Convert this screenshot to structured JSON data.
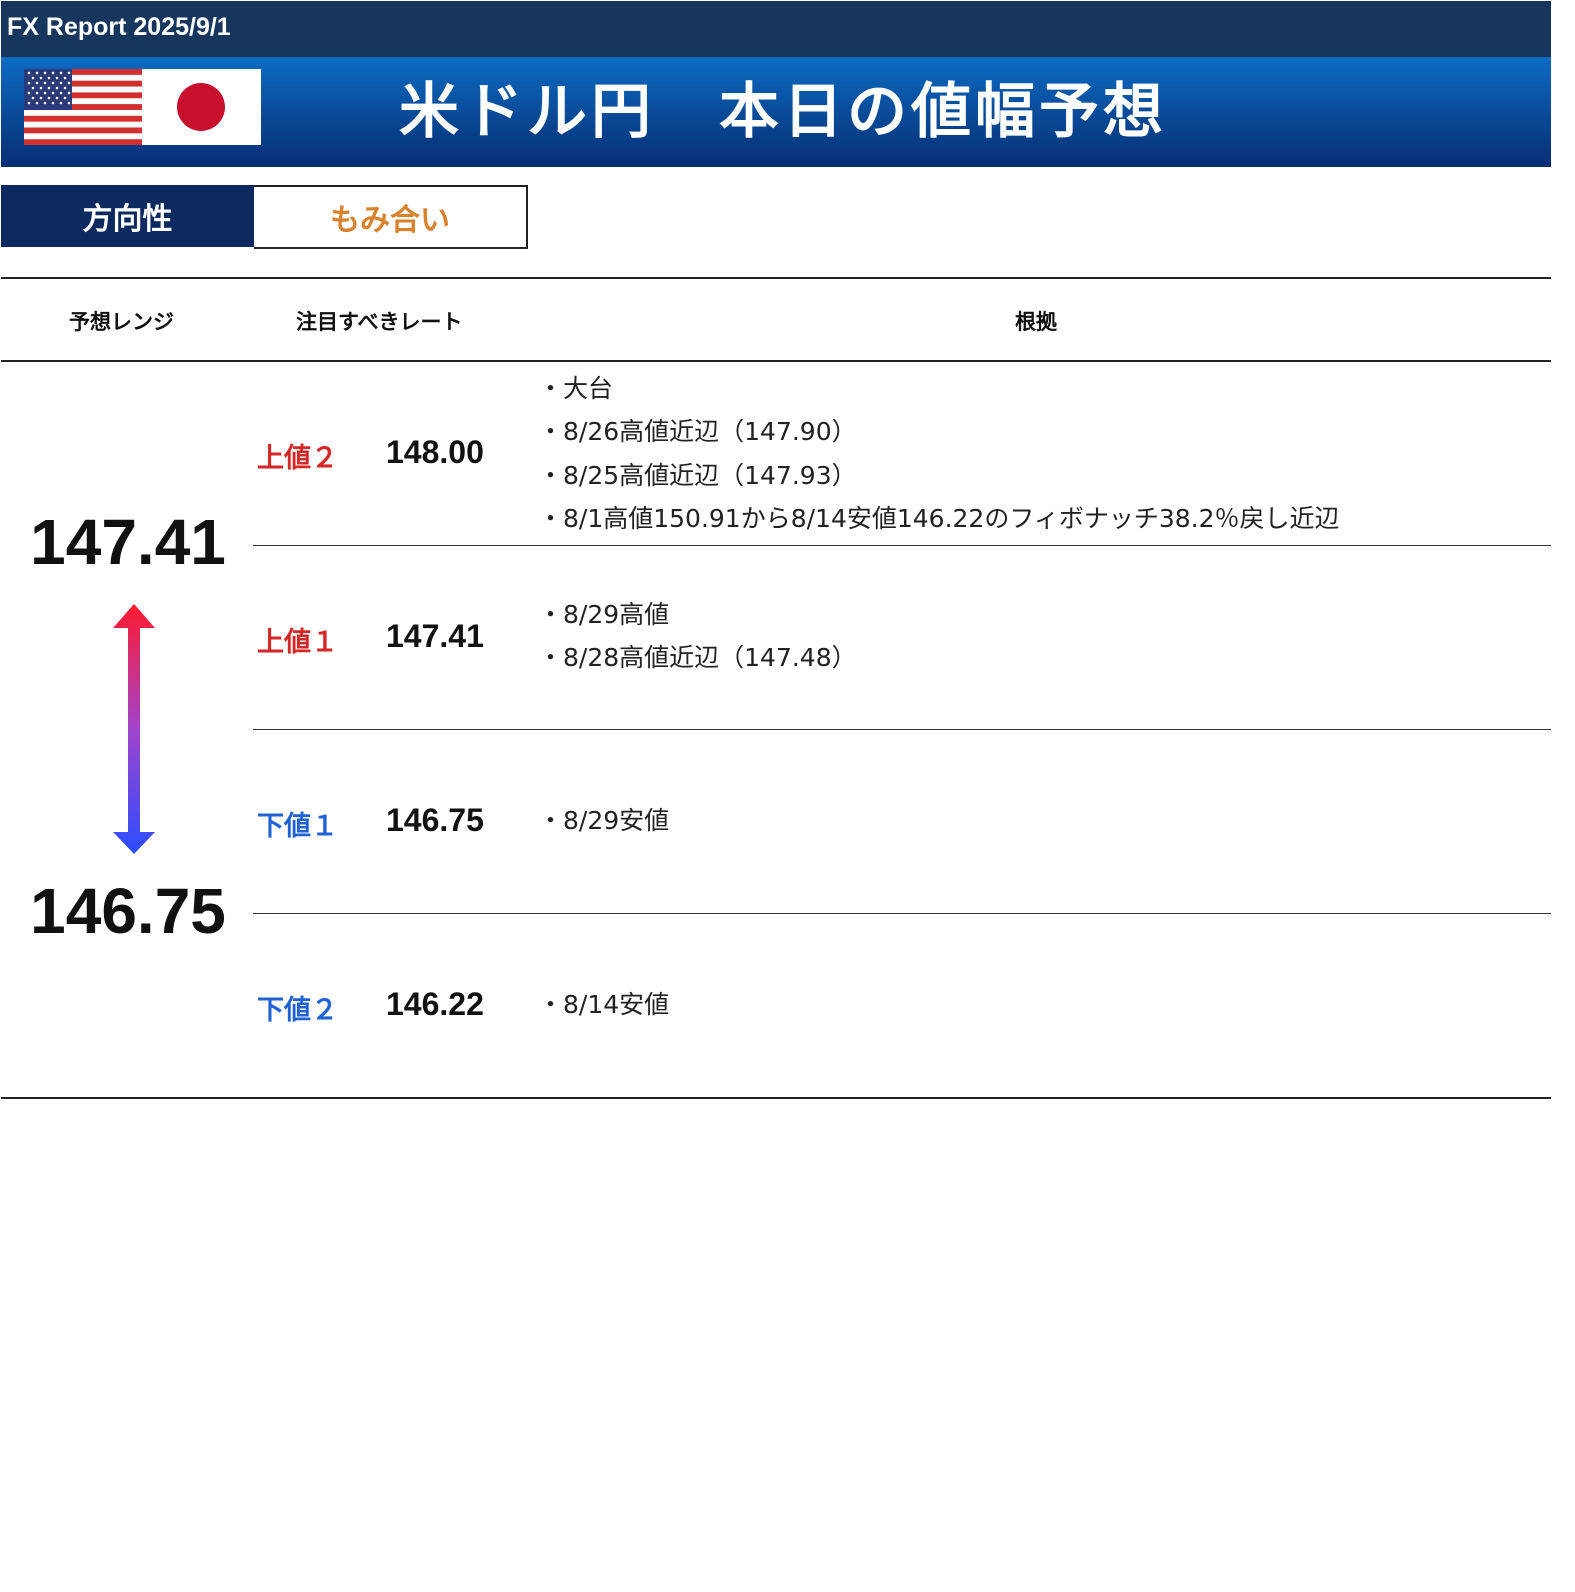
{
  "header": {
    "report_label": "FX Report 2025/9/1",
    "title": "米ドル円　本日の値幅予想",
    "flags": [
      "us-flag",
      "japan-flag"
    ]
  },
  "direction": {
    "label": "方向性",
    "value": "もみ合い"
  },
  "columns": {
    "range": "予想レンジ",
    "rates": "注目すべきレート",
    "reason": "根拠"
  },
  "forecast_range": {
    "high": "147.41",
    "low": "146.75"
  },
  "levels": [
    {
      "label": "上値２",
      "rate": "148.00",
      "reasons": [
        "・大台",
        "・8/26高値近辺（147.90）",
        "・8/25高値近辺（147.93）",
        "・8/1高値150.91から8/14安値146.22のフィボナッチ38.2％戻し近辺"
      ]
    },
    {
      "label": "上値１",
      "rate": "147.41",
      "reasons": [
        "・8/29高値",
        "・8/28高値近辺（147.48）"
      ]
    },
    {
      "label": "下値１",
      "rate": "146.75",
      "reasons": [
        "・8/29安値"
      ]
    },
    {
      "label": "下値２",
      "rate": "146.22",
      "reasons": [
        "・8/14安値"
      ]
    }
  ],
  "colors": {
    "header_bg": "#17365d",
    "banner_top": "#0c6bc3",
    "banner_bottom": "#062e74",
    "direction_bg": "#0d2a60",
    "direction_value": "#d9822b",
    "upper_label": "#d62626",
    "lower_label": "#1f62d6",
    "arrow_top": "#ff1a2e",
    "arrow_bottom": "#2a4dff"
  }
}
